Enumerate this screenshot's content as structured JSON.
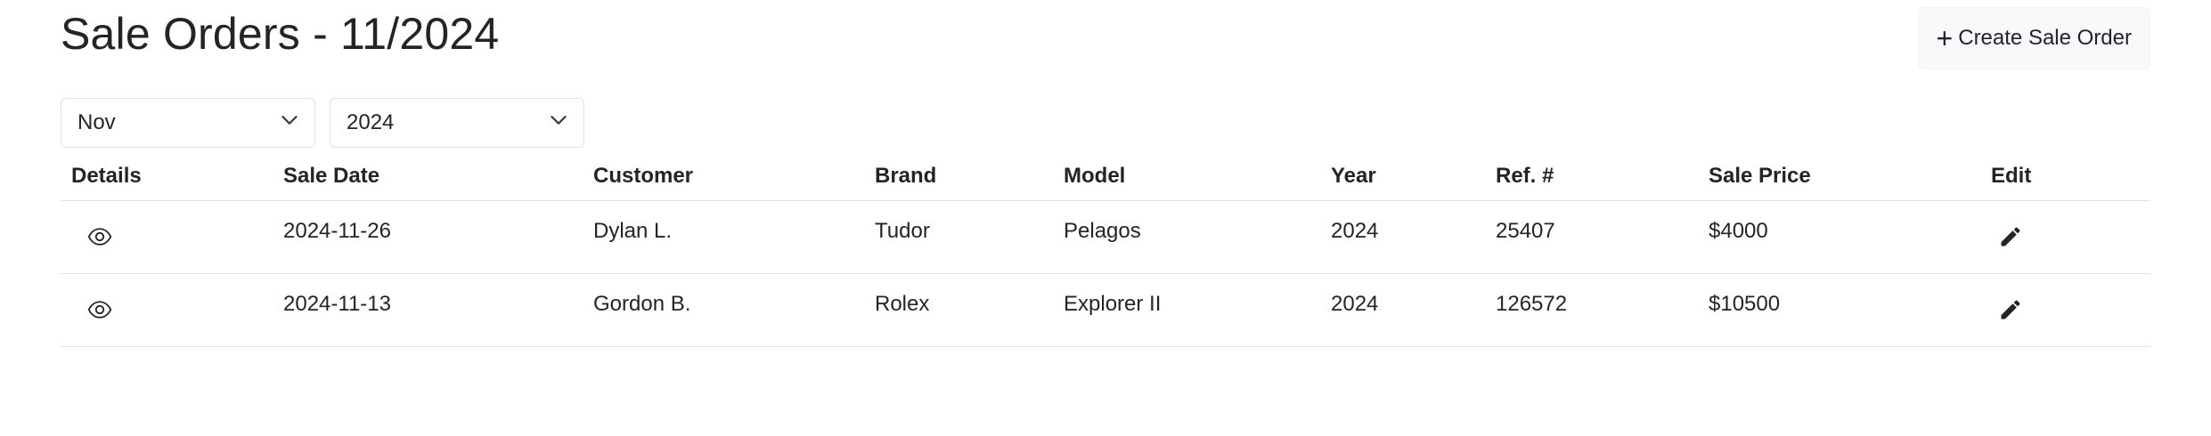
{
  "page": {
    "title": "Sale Orders - 11/2024",
    "create_button_label": "Create Sale Order"
  },
  "filters": {
    "month": "Nov",
    "year": "2024"
  },
  "table": {
    "headers": {
      "details": "Details",
      "sale_date": "Sale Date",
      "customer": "Customer",
      "brand": "Brand",
      "model": "Model",
      "year": "Year",
      "ref": "Ref. #",
      "sale_price": "Sale Price",
      "edit": "Edit"
    },
    "rows": [
      {
        "sale_date": "2024-11-26",
        "customer": "Dylan L.",
        "brand": "Tudor",
        "model": "Pelagos",
        "year": "2024",
        "ref": "25407",
        "sale_price": "$4000"
      },
      {
        "sale_date": "2024-11-13",
        "customer": "Gordon B.",
        "brand": "Rolex",
        "model": "Explorer II",
        "year": "2024",
        "ref": "126572",
        "sale_price": "$10500"
      }
    ]
  },
  "icons": {
    "details": "eye-icon",
    "edit": "pencil-icon",
    "create": "plus-icon",
    "select": "chevron-down-icon"
  }
}
